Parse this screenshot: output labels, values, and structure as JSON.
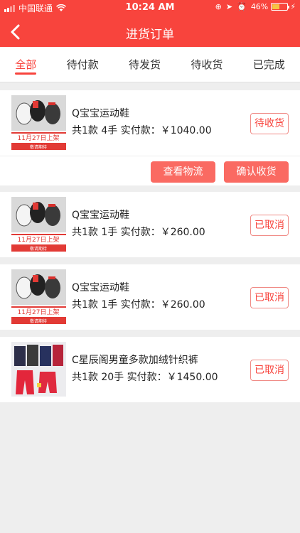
{
  "status_bar": {
    "carrier": "中国联通",
    "time": "10:24 AM",
    "battery": "46%"
  },
  "header": {
    "title": "进货订单",
    "back_icon": "back-arrow-icon"
  },
  "tabs": [
    {
      "label": "全部",
      "active": true
    },
    {
      "label": "待付款",
      "active": false
    },
    {
      "label": "待发货",
      "active": false
    },
    {
      "label": "待收货",
      "active": false
    },
    {
      "label": "已完成",
      "active": false
    }
  ],
  "orders": [
    {
      "name": "Q宝宝运动鞋",
      "meta": "共1款 4手 实付款：￥1040.00",
      "status": "待收货",
      "image_banner": "11月27日上架",
      "image_caption": "敬请期待",
      "actions": [
        "查看物流",
        "确认收货"
      ]
    },
    {
      "name": "Q宝宝运动鞋",
      "meta": "共1款 1手 实付款：￥260.00",
      "status": "已取消",
      "image_banner": "11月27日上架",
      "image_caption": "敬请期待"
    },
    {
      "name": "Q宝宝运动鞋",
      "meta": "共1款 1手 实付款：￥260.00",
      "status": "已取消",
      "image_banner": "11月27日上架",
      "image_caption": "敬请期待"
    },
    {
      "name": "C星辰阁男童多款加绒针织裤",
      "meta": "共1款 20手 实付款：￥1450.00",
      "status": "已取消"
    }
  ],
  "colors": {
    "brand": "#f8443d",
    "button": "#fa6a62",
    "background": "#eeeeee"
  }
}
